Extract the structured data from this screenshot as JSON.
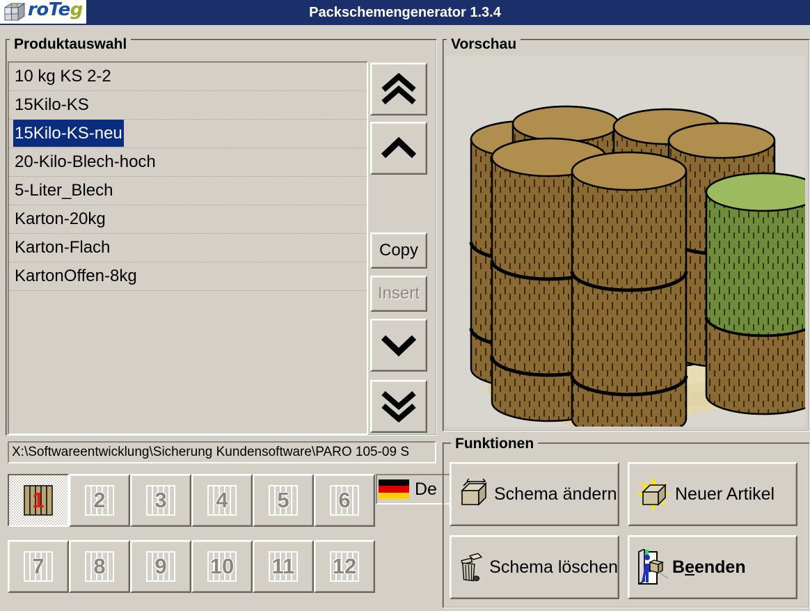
{
  "window": {
    "title": "Packschemengenerator 1.3.4",
    "logo_text_main": "roTe",
    "logo_text_accent": "g",
    "titlebar_color": "#1b2f6b",
    "face_color": "#d4d0c8"
  },
  "product_panel": {
    "title": "Produktauswahl",
    "items": [
      {
        "label": "10 kg KS 2-2",
        "selected": false
      },
      {
        "label": "15Kilo-KS",
        "selected": false
      },
      {
        "label": "15Kilo-KS-neu",
        "selected": true
      },
      {
        "label": "20-Kilo-Blech-hoch",
        "selected": false
      },
      {
        "label": "5-Liter_Blech",
        "selected": false
      },
      {
        "label": "Karton-20kg",
        "selected": false
      },
      {
        "label": "Karton-Flach",
        "selected": false
      },
      {
        "label": "KartonOffen-8kg",
        "selected": false
      }
    ],
    "selection_color": "#0b2d7f",
    "side_buttons": [
      {
        "name": "move-top",
        "label": "",
        "icon": "double-chevron-up-icon",
        "disabled": false
      },
      {
        "name": "move-up",
        "label": "",
        "icon": "chevron-up-icon",
        "disabled": false
      },
      {
        "name": "copy",
        "label": "Copy",
        "icon": "",
        "disabled": false
      },
      {
        "name": "insert",
        "label": "Insert",
        "icon": "",
        "disabled": true
      },
      {
        "name": "move-down",
        "label": "",
        "icon": "chevron-down-icon",
        "disabled": false
      },
      {
        "name": "move-bottom",
        "label": "",
        "icon": "double-chevron-down-icon",
        "disabled": false
      }
    ]
  },
  "path_field": {
    "value": "X:\\Softwareentwicklung\\Sicherung Kundensoftware\\PARO 105-09 S"
  },
  "pallet_buttons": {
    "items": [
      {
        "number": "1",
        "active": true
      },
      {
        "number": "2",
        "active": false
      },
      {
        "number": "3",
        "active": false
      },
      {
        "number": "4",
        "active": false
      },
      {
        "number": "5",
        "active": false
      },
      {
        "number": "6",
        "active": false
      },
      {
        "number": "7",
        "active": false
      },
      {
        "number": "8",
        "active": false
      },
      {
        "number": "9",
        "active": false
      },
      {
        "number": "10",
        "active": false
      },
      {
        "number": "11",
        "active": false
      },
      {
        "number": "12",
        "active": false
      }
    ]
  },
  "language": {
    "flag": "german-flag-icon",
    "label": "De"
  },
  "preview_panel": {
    "title": "Vorschau",
    "background": "#d9d6d0",
    "drum_color": "#8a6a32",
    "drum_top_color": "#b08f4e",
    "highlight_drum_color": "#6f8c3a",
    "highlight_drum_top_color": "#9cbb5e",
    "pallet_color": "#e3d7ac"
  },
  "functions_panel": {
    "title": "Funktionen",
    "buttons": [
      {
        "name": "schema-aendern",
        "label": "Schema ändern",
        "icon": "box-measure-icon",
        "bold": false,
        "accel": ""
      },
      {
        "name": "neuer-artikel",
        "label": "Neuer Artikel",
        "icon": "new-box-sparkle-icon",
        "bold": false,
        "accel": ""
      },
      {
        "name": "schema-loeschen",
        "label": "Schema löschen",
        "icon": "trash-can-icon",
        "bold": false,
        "accel": ""
      },
      {
        "name": "beenden",
        "label_before": "B",
        "label_accel": "e",
        "label_after": "enden",
        "label": "Beenden",
        "icon": "exit-door-icon",
        "bold": true
      }
    ]
  }
}
